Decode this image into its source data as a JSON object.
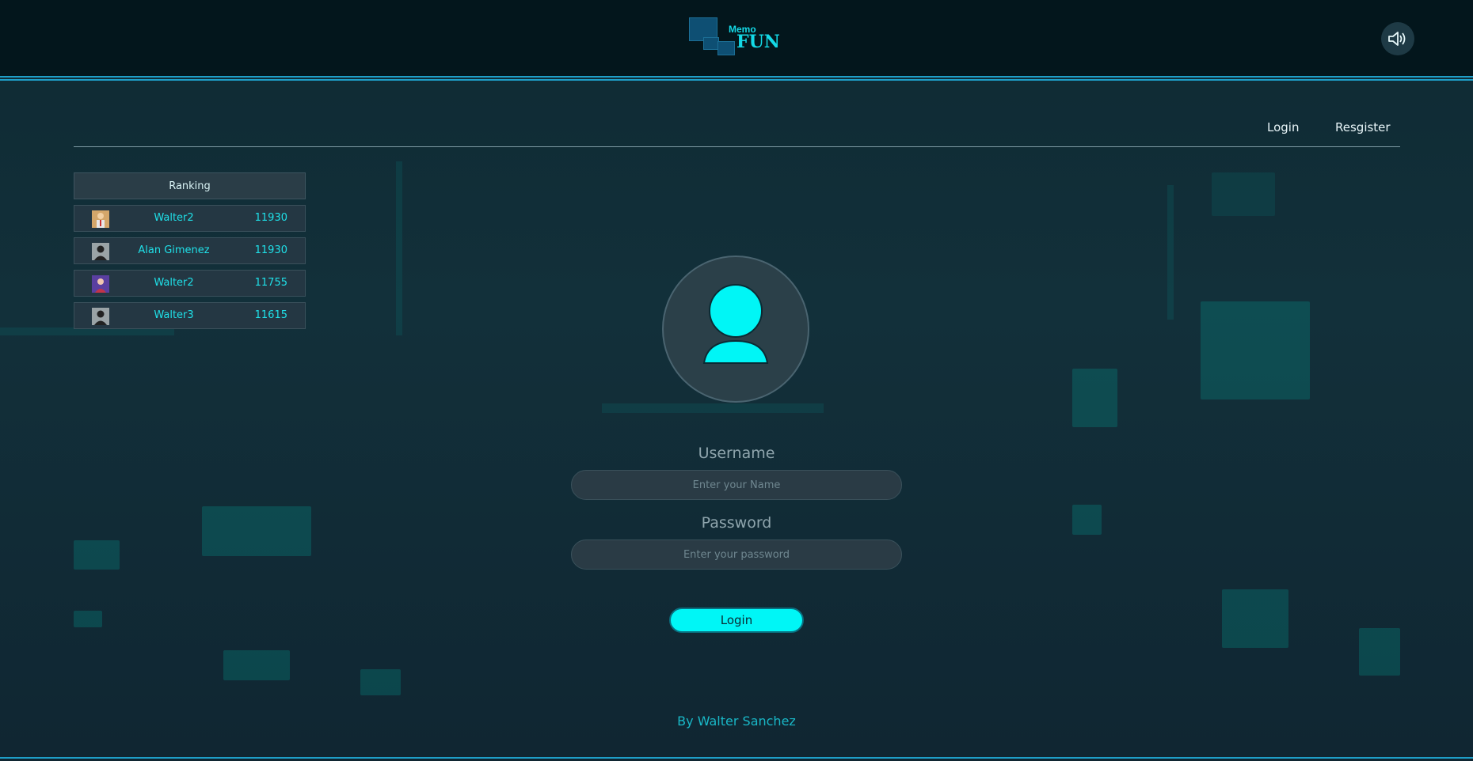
{
  "header": {
    "logo_small": "Memo",
    "logo_big": "FUN",
    "sound_icon": "speaker-icon"
  },
  "nav": {
    "login": "Login",
    "register": "Resgister"
  },
  "ranking": {
    "title": "Ranking",
    "rows": [
      {
        "name": "Walter2",
        "score": "11930",
        "avatar": "avatar-cartoon"
      },
      {
        "name": "Alan Gimenez",
        "score": "11930",
        "avatar": "avatar-default"
      },
      {
        "name": "Walter2",
        "score": "11755",
        "avatar": "avatar-cartoon"
      },
      {
        "name": "Walter3",
        "score": "11615",
        "avatar": "avatar-default"
      }
    ]
  },
  "form": {
    "username_label": "Username",
    "username_placeholder": "Enter your Name",
    "password_label": "Password",
    "password_placeholder": "Enter your password",
    "login_button": "Login"
  },
  "footer": {
    "credit": "By Walter Sanchez"
  },
  "colors": {
    "accent": "#00f6f6",
    "line": "#1e9ec7"
  }
}
